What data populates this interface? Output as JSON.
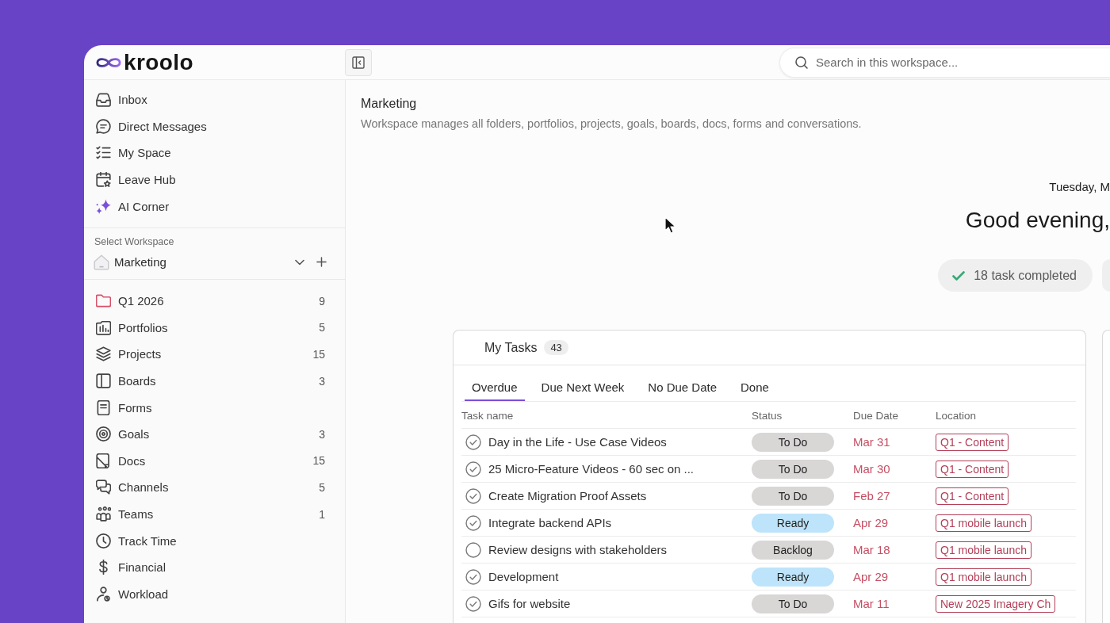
{
  "logo": {
    "text": "kroolo"
  },
  "search": {
    "placeholder": "Search in this workspace..."
  },
  "sidebar": {
    "nav": [
      {
        "label": "Inbox"
      },
      {
        "label": "Direct Messages"
      },
      {
        "label": "My Space"
      },
      {
        "label": "Leave Hub"
      },
      {
        "label": "AI Corner"
      }
    ],
    "workspace": {
      "caption": "Select Workspace",
      "name": "Marketing"
    },
    "items": [
      {
        "label": "Q1 2026",
        "count": "9"
      },
      {
        "label": "Portfolios",
        "count": "5"
      },
      {
        "label": "Projects",
        "count": "15"
      },
      {
        "label": "Boards",
        "count": "3"
      },
      {
        "label": "Forms"
      },
      {
        "label": "Goals",
        "count": "3"
      },
      {
        "label": "Docs",
        "count": "15"
      },
      {
        "label": "Channels",
        "count": "5"
      },
      {
        "label": "Teams",
        "count": "1"
      },
      {
        "label": "Track Time"
      },
      {
        "label": "Financial"
      },
      {
        "label": "Workload"
      }
    ]
  },
  "workspace_header": {
    "title": "Marketing",
    "description": "Workspace manages all folders, portfolios, projects, goals, boards, docs, forms and conversations."
  },
  "greeting": {
    "date": "Tuesday, M",
    "message": "Good evening,",
    "stats": [
      "18 task completed"
    ]
  },
  "tasks": {
    "title": "My Tasks",
    "count": "43",
    "tabs": [
      {
        "label": "Overdue",
        "selected": true
      },
      {
        "label": "Due Next Week",
        "selected": false
      },
      {
        "label": "No Due Date",
        "selected": false
      },
      {
        "label": "Done",
        "selected": false
      }
    ],
    "columns": [
      "Task name",
      "Status",
      "Due Date",
      "Location"
    ],
    "rows": [
      {
        "checked": true,
        "name": "Day in the Life - Use Case Videos",
        "status": {
          "label": "To Do",
          "color": "#d9d6d6"
        },
        "due": "Mar 31",
        "location": "Q1 - Content"
      },
      {
        "checked": true,
        "name": "25 Micro-Feature Videos - 60 sec on ...",
        "status": {
          "label": "To Do",
          "color": "#d9d6d6"
        },
        "due": "Mar 30",
        "location": "Q1 - Content"
      },
      {
        "checked": true,
        "name": "Create Migration Proof Assets",
        "status": {
          "label": "To Do",
          "color": "#d9d6d6"
        },
        "due": "Feb 27",
        "location": "Q1 - Content"
      },
      {
        "checked": true,
        "name": "Integrate backend APIs",
        "status": {
          "label": "Ready",
          "color": "#bde4fa"
        },
        "due": "Apr 29",
        "location": "Q1 mobile launch"
      },
      {
        "checked": false,
        "name": "Review designs with stakeholders",
        "status": {
          "label": "Backlog",
          "color": "#d9d6d6"
        },
        "due": "Mar 18",
        "location": "Q1 mobile launch"
      },
      {
        "checked": true,
        "name": "Development",
        "status": {
          "label": "Ready",
          "color": "#bde4fa"
        },
        "due": "Apr 29",
        "location": "Q1 mobile launch"
      },
      {
        "checked": true,
        "name": "Gifs for website",
        "status": {
          "label": "To Do",
          "color": "#d9d6d6"
        },
        "due": "Mar 11",
        "location": "New 2025 Imagery Ch"
      }
    ]
  }
}
